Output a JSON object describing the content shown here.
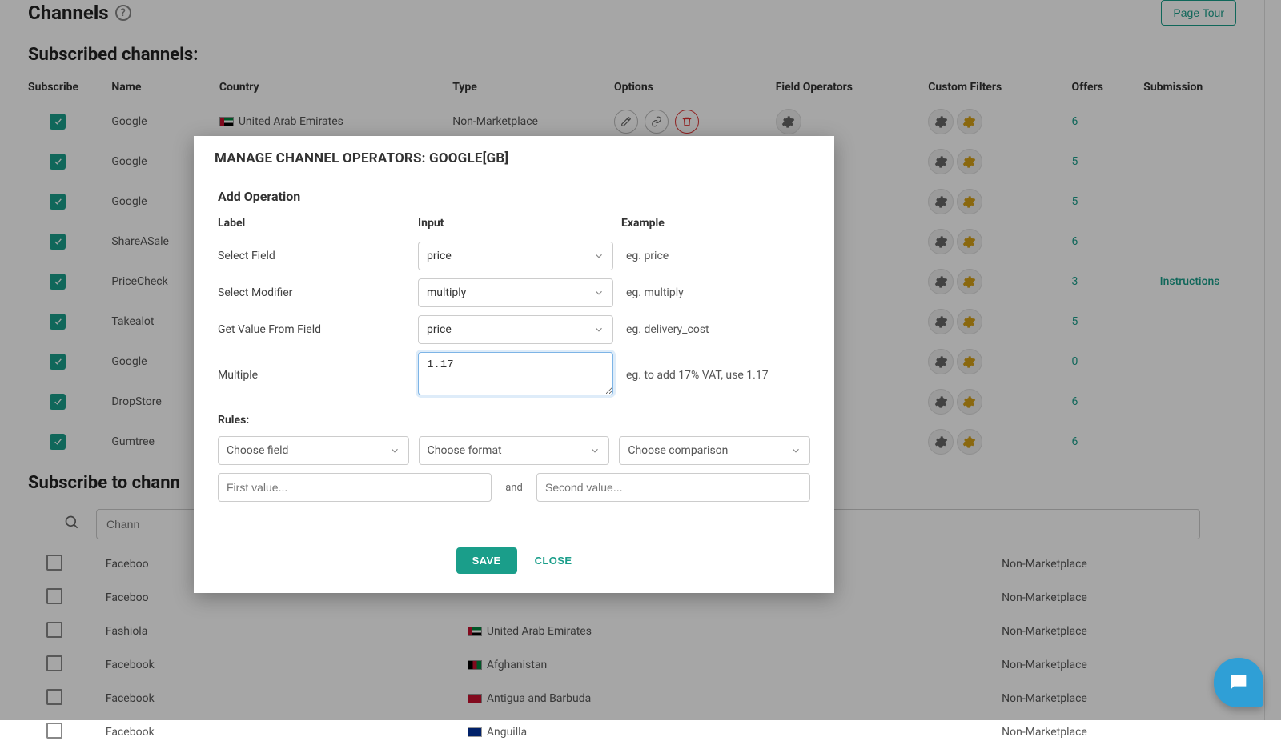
{
  "header": {
    "title": "Channels",
    "page_tour": "Page Tour"
  },
  "subscribed": {
    "title": "Subscribed channels:",
    "cols": {
      "subscribe": "Subscribe",
      "name": "Name",
      "country": "Country",
      "type": "Type",
      "options": "Options",
      "operators": "Field Operators",
      "filters": "Custom Filters",
      "offers": "Offers",
      "submission": "Submission"
    },
    "rows": [
      {
        "name": "Google",
        "country": "United Arab Emirates",
        "flag": "ae",
        "type": "Non-Marketplace",
        "offers": "6",
        "submission": ""
      },
      {
        "name": "Google",
        "country": "",
        "flag": "",
        "type": "",
        "offers": "5",
        "submission": ""
      },
      {
        "name": "Google",
        "country": "",
        "flag": "",
        "type": "",
        "offers": "5",
        "submission": ""
      },
      {
        "name": "ShareASale",
        "country": "",
        "flag": "",
        "type": "",
        "offers": "6",
        "submission": ""
      },
      {
        "name": "PriceCheck",
        "country": "",
        "flag": "",
        "type": "",
        "offers": "3",
        "submission": "Instructions"
      },
      {
        "name": "Takealot",
        "country": "",
        "flag": "",
        "type": "",
        "offers": "5",
        "submission": ""
      },
      {
        "name": "Google",
        "country": "",
        "flag": "",
        "type": "",
        "offers": "0",
        "submission": ""
      },
      {
        "name": "DropStore",
        "country": "",
        "flag": "",
        "type": "",
        "offers": "6",
        "submission": ""
      },
      {
        "name": "Gumtree",
        "country": "",
        "flag": "",
        "type": "",
        "offers": "6",
        "submission": ""
      }
    ]
  },
  "subscribe_to": {
    "title": "Subscribe to chann",
    "search_placeholder": "Chann",
    "type_label": "Non-Marketplace",
    "rows": [
      {
        "name": "Faceboo",
        "country": "",
        "flag": ""
      },
      {
        "name": "Faceboo",
        "country": "",
        "flag": ""
      },
      {
        "name": "Fashiola",
        "country": "United Arab Emirates",
        "flag": "ae"
      },
      {
        "name": "Facebook",
        "country": "Afghanistan",
        "flag": "af"
      },
      {
        "name": "Facebook",
        "country": "Antigua and Barbuda",
        "flag": "ag"
      },
      {
        "name": "Facebook",
        "country": "Anguilla",
        "flag": "ai"
      }
    ]
  },
  "modal": {
    "title": "MANAGE CHANNEL OPERATORS: GOOGLE[GB]",
    "add_op": "Add Operation",
    "head_label": "Label",
    "head_input": "Input",
    "head_example": "Example",
    "rows": [
      {
        "label": "Select Field",
        "value": "price",
        "example": "eg. price",
        "type": "select"
      },
      {
        "label": "Select Modifier",
        "value": "multiply",
        "example": "eg. multiply",
        "type": "select"
      },
      {
        "label": "Get Value From Field",
        "value": "price",
        "example": "eg. delivery_cost",
        "type": "select"
      },
      {
        "label": "Multiple",
        "value": "1.17",
        "example": "eg. to add 17% VAT, use 1.17",
        "type": "textarea"
      }
    ],
    "rules_title": "Rules:",
    "choose_field": "Choose field",
    "choose_format": "Choose format",
    "choose_comparison": "Choose comparison",
    "first_value_ph": "First value...",
    "and": "and",
    "second_value_ph": "Second value...",
    "save": "SAVE",
    "close": "CLOSE"
  }
}
